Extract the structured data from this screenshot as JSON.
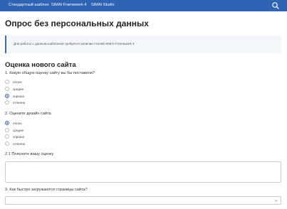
{
  "nav": {
    "items": [
      {
        "label": "Стандартный шаблон"
      },
      {
        "label": "SIMAI Framework 4"
      },
      {
        "label": "SIMAI Studio"
      }
    ],
    "search_icon": "search-icon",
    "bar_color": "#2f63b4"
  },
  "page": {
    "title": "Опрос без персональных данных",
    "notice": "Для работы с данным шаблоном требуется наличие стилей SIMAI Framework 4"
  },
  "survey": {
    "section_title": "Оценка нового сайта",
    "q1": {
      "label": "1. Какую общую оценку сайту вы бы поставили?",
      "options": [
        {
          "label": "плохо",
          "selected": false
        },
        {
          "label": "средне",
          "selected": false
        },
        {
          "label": "хорошо",
          "selected": true
        },
        {
          "label": "отлично",
          "selected": false
        }
      ]
    },
    "q2": {
      "label": "2. Оцените дизайн сайта",
      "options": [
        {
          "label": "плохо",
          "selected": true
        },
        {
          "label": "средне",
          "selected": false
        },
        {
          "label": "хорошо",
          "selected": false
        },
        {
          "label": "отлично",
          "selected": false
        }
      ]
    },
    "q2_1": {
      "label": "2.1 Поясните вашу оценку",
      "value": ""
    },
    "q3": {
      "label": "3. Как быстро загружаются страницы сайта?",
      "selected": ""
    },
    "accent_color": "#3c5fb0"
  }
}
